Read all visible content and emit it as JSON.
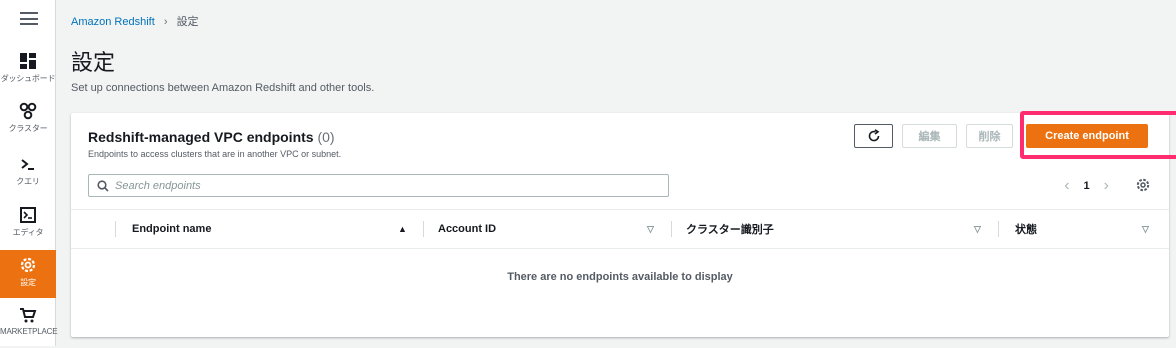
{
  "nav": {
    "items": [
      {
        "label": "ダッシュボード",
        "icon": "dashboard-icon"
      },
      {
        "label": "クラスター",
        "icon": "clusters-icon"
      },
      {
        "label": "クエリ",
        "icon": "query-icon"
      },
      {
        "label": "エディタ",
        "icon": "editor-icon"
      },
      {
        "label": "設定",
        "icon": "settings-icon",
        "active": true
      },
      {
        "label": "MARKETPLACE",
        "icon": "marketplace-icon"
      }
    ]
  },
  "breadcrumb": {
    "root": "Amazon Redshift",
    "current": "設定"
  },
  "page": {
    "title": "設定",
    "subtitle": "Set up connections between Amazon Redshift and other tools."
  },
  "panel": {
    "title": "Redshift-managed VPC endpoints",
    "count": "(0)",
    "description": "Endpoints to access clusters that are in another VPC or subnet.",
    "buttons": {
      "edit": "編集",
      "delete": "削除",
      "create": "Create endpoint"
    },
    "search_placeholder": "Search endpoints",
    "page_number": "1",
    "columns": [
      "Endpoint name",
      "Account ID",
      "クラスター識別子",
      "状態"
    ],
    "empty_message": "There are no endpoints available to display"
  },
  "colors": {
    "accent": "#ec7211",
    "link": "#0073bb",
    "highlight": "#ff2d6f"
  }
}
